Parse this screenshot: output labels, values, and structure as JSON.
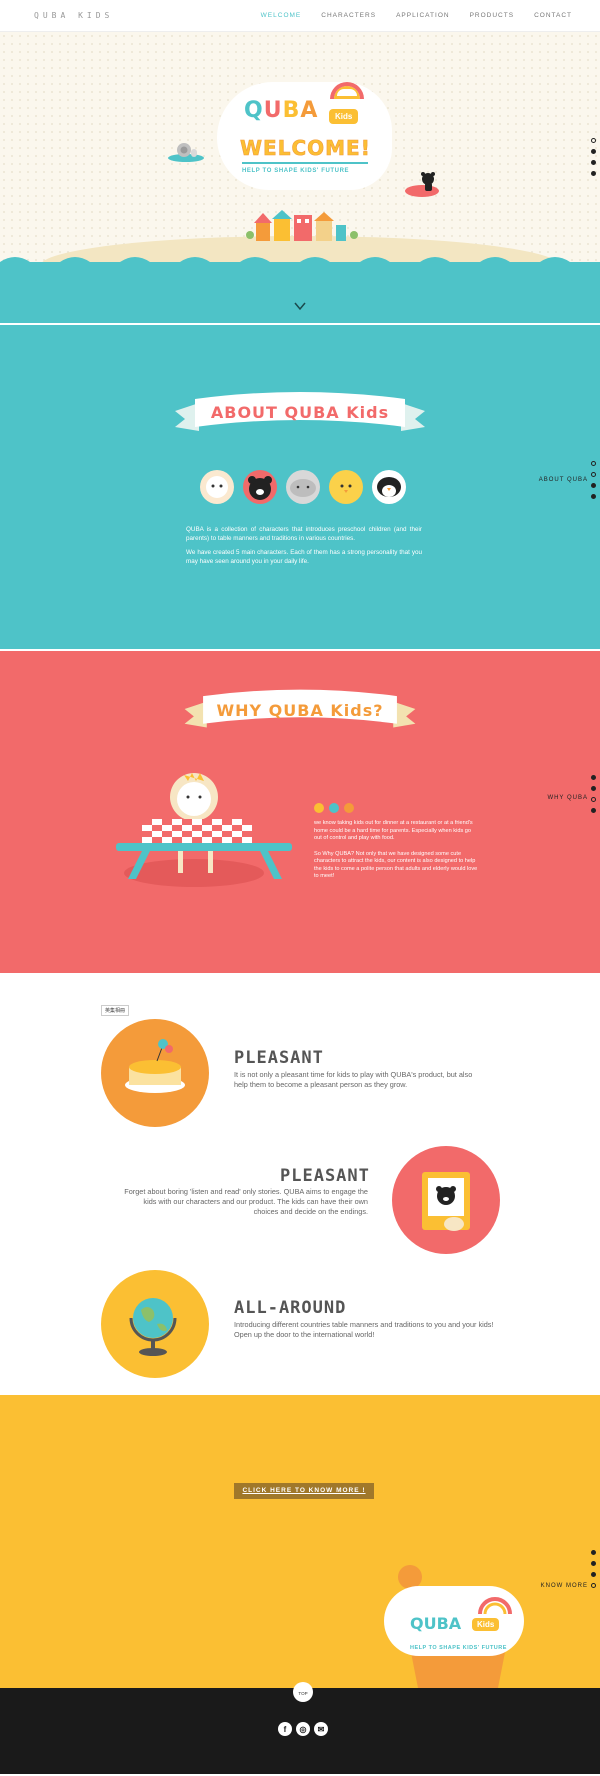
{
  "nav": {
    "logo": "QUBA KIDS",
    "items": [
      "WELCOME",
      "CHARACTERS",
      "APPLICATION",
      "PRODUCTS",
      "CONTACT"
    ]
  },
  "hero": {
    "logo_letters": [
      "Q",
      "U",
      "B",
      "A"
    ],
    "kids_badge": "Kids",
    "welcome": "WELCOME!",
    "tagline": "HELP TO SHAPE KIDS' FUTURE"
  },
  "about": {
    "title": "ABOUT QUBA Kids",
    "side_label": "ABOUT QUBA",
    "paragraphs": [
      "QUBA is a collection of characters that introduces preschool children (and their parents) to table manners and traditions in various countries.",
      "We have created 5 main characters. Each of them has a strong personality that you may have seen around you in your daily life."
    ],
    "characters": [
      "lion-icon",
      "bear-icon",
      "elephant-icon",
      "chick-icon",
      "penguin-icon"
    ]
  },
  "why": {
    "title": "WHY QUBA Kids?",
    "side_label": "WHY QUBA",
    "paragraphs": [
      "we know taking kids out for dinner at a restaurant or at a friend's home could be a hard time for parents. Especially when kids go out of control and play with food.",
      "So Why QUBA? Not only that we have designed some cute characters to attract the kids, our content is also designed to help the kids to come a polite person that adults and elderly would love to meet!"
    ]
  },
  "features": {
    "tag": "英集相冊",
    "items": [
      {
        "title": "PLEASANT",
        "text": "It is not only a pleasant time for kids to play with QUBA's product, but also help them to become a pleasant person as they grow."
      },
      {
        "title": "PLEASANT",
        "text": "Forget about boring 'listen and read' only stories. QUBA aims to engage the kids with our characters and our product. The kids can have their own choices and decide on the endings."
      },
      {
        "title": "ALL-AROUND",
        "text": "Introducing different countries table manners and traditions to you and your kids! Open up the door to the international world!"
      }
    ]
  },
  "know": {
    "cta": "CLICK HERE TO KNOW MORE !",
    "side_label": "KNOW MORE",
    "logo": "QUBA",
    "kids_badge": "Kids",
    "tagline": "HELP TO SHAPE KIDS' FUTURE"
  },
  "footer": {
    "top": "TOP",
    "social": [
      "f",
      "◎",
      "✉"
    ]
  },
  "colors": {
    "teal": "#4ec3c8",
    "coral": "#f26a6a",
    "yellow": "#fbbf33",
    "orange": "#f49b3a"
  }
}
